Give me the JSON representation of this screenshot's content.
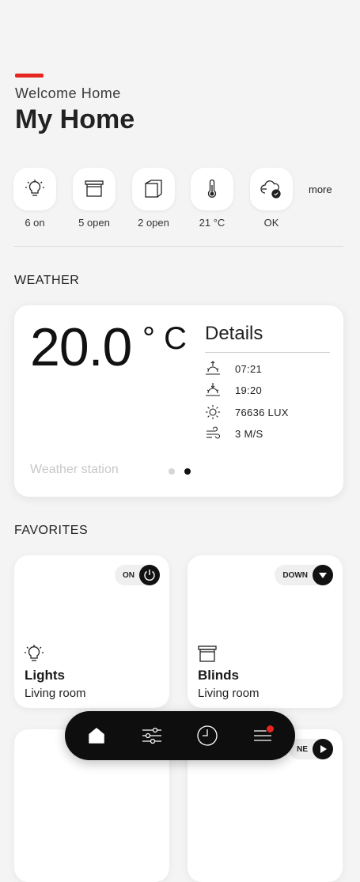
{
  "header": {
    "welcome": "Welcome Home",
    "title": "My Home",
    "accent_color": "#e52620"
  },
  "status_items": [
    {
      "icon": "bulb-icon",
      "label": "6 on"
    },
    {
      "icon": "blind-icon",
      "label": "5 open"
    },
    {
      "icon": "window-icon",
      "label": "2 open"
    },
    {
      "icon": "thermometer-icon",
      "label": "21 °C"
    },
    {
      "icon": "system-status-icon",
      "label": "OK"
    }
  ],
  "status_more": "more",
  "weather": {
    "section_title": "WEATHER",
    "temperature": "20.0",
    "unit": "° C",
    "details_title": "Details",
    "sunrise": "07:21",
    "sunset": "19:20",
    "brightness": "76636 LUX",
    "wind": "3 M/S",
    "station_label": "Weather station",
    "page_count": 2,
    "active_page": 2
  },
  "favorites": {
    "section_title": "FAVORITES",
    "items": [
      {
        "status": "ON",
        "name": "Lights",
        "room": "Living room",
        "icon": "bulb-icon",
        "action_icon": "power-icon"
      },
      {
        "status": "DOWN",
        "name": "Blinds",
        "room": "Living room",
        "icon": "blind-icon",
        "action_icon": "arrow-down-icon"
      },
      {
        "status": "",
        "name": "",
        "room": "",
        "icon": "",
        "action_icon": ""
      },
      {
        "status": "NE",
        "name": "",
        "room": "",
        "icon": "",
        "action_icon": "play-icon"
      }
    ]
  },
  "nav": {
    "items": [
      "home-icon",
      "sliders-icon",
      "clock-icon",
      "menu-icon"
    ],
    "active": "home-icon",
    "badge_color": "#e52620"
  }
}
